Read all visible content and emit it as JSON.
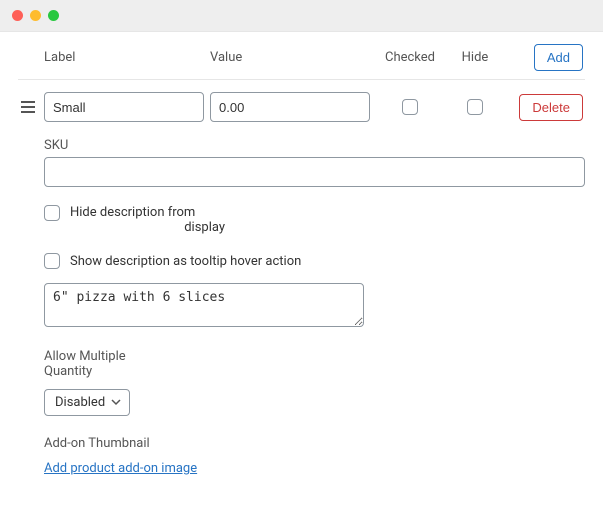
{
  "headers": {
    "label": "Label",
    "value": "Value",
    "checked": "Checked",
    "hide": "Hide",
    "add": "Add"
  },
  "row": {
    "label_value": "Small",
    "value_value": "0.00",
    "delete": "Delete"
  },
  "sku": {
    "label": "SKU",
    "value": ""
  },
  "hide_desc": {
    "line1": "Hide description from",
    "line2": "display"
  },
  "tooltip_desc": "Show description as tooltip hover action",
  "description": "6\" pizza with 6 slices",
  "multi_qty": {
    "label_line1": "Allow Multiple",
    "label_line2": "Quantity",
    "selected": "Disabled"
  },
  "thumb": {
    "label": "Add-on Thumbnail",
    "link": "Add product add-on image"
  }
}
